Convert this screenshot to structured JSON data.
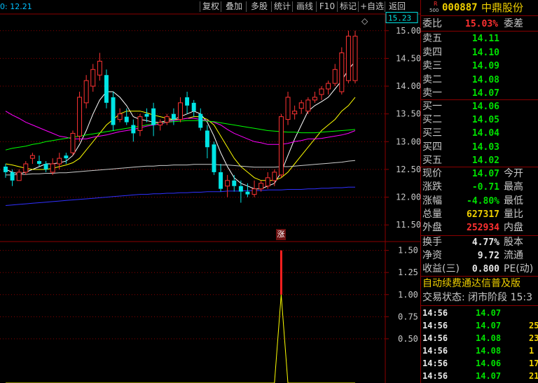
{
  "toolbar": {
    "ohlc_readout": "0: 12.21",
    "buttons": [
      "复权",
      "叠加",
      "多股",
      "统计",
      "画线",
      "F10",
      "标记",
      "+自选",
      "返回"
    ]
  },
  "chart_markers": {
    "zhang": "涨",
    "diamond": "◇"
  },
  "colors": {
    "up": "#ff3333",
    "down": "#00e5e5",
    "ma5": "#ffffff",
    "ma10": "#ffff00",
    "ma20": "#ff00ff",
    "ma30": "#00ff00",
    "ma60": "#cccccc",
    "ma120": "#3030ff",
    "grid": "#8b0000",
    "axis_text": "#c8c8c8"
  },
  "stock": {
    "badge_top": "R",
    "badge_bottom": "500",
    "code": "000887",
    "name": "中鼎股份"
  },
  "weibi": {
    "label": "委比",
    "value": "15.03%",
    "label2": "委差"
  },
  "asks": [
    {
      "label": "卖五",
      "price": "14.11"
    },
    {
      "label": "卖四",
      "price": "14.10"
    },
    {
      "label": "卖三",
      "price": "14.09"
    },
    {
      "label": "卖二",
      "price": "14.08"
    },
    {
      "label": "卖一",
      "price": "14.07"
    }
  ],
  "bids": [
    {
      "label": "买一",
      "price": "14.06"
    },
    {
      "label": "买二",
      "price": "14.05"
    },
    {
      "label": "买三",
      "price": "14.04"
    },
    {
      "label": "买四",
      "price": "14.03"
    },
    {
      "label": "买五",
      "price": "14.02"
    }
  ],
  "quote": [
    {
      "label": "现价",
      "value": "14.07",
      "label2": "今开",
      "color": "green"
    },
    {
      "label": "涨跌",
      "value": "-0.71",
      "label2": "最高",
      "color": "green"
    },
    {
      "label": "涨幅",
      "value": "-4.80%",
      "label2": "最低",
      "color": "green"
    },
    {
      "label": "总量",
      "value": "627317",
      "label2": "量比",
      "color": "yellow"
    },
    {
      "label": "外盘",
      "value": "252934",
      "label2": "内盘",
      "color": "red"
    }
  ],
  "fundamentals": [
    {
      "label": "换手",
      "value": "4.77%",
      "label2": "股本"
    },
    {
      "label": "净资",
      "value": "9.72",
      "label2": "流通"
    },
    {
      "label": "收益(三)",
      "value": "0.800",
      "label2": "PE(动)"
    }
  ],
  "promo_text": "自动续费通达信普及版",
  "trade_status": "交易状态: 闭市阶段 15:3",
  "ticks": [
    {
      "time": "14:56",
      "price": "14.07",
      "vol": "",
      "color": "green"
    },
    {
      "time": "14:56",
      "price": "14.07",
      "vol": "25",
      "color": "green"
    },
    {
      "time": "14:56",
      "price": "14.08",
      "vol": "23",
      "color": "green"
    },
    {
      "time": "14:56",
      "price": "14.08",
      "vol": "1",
      "color": "green"
    },
    {
      "time": "14:56",
      "price": "14.06",
      "vol": "17",
      "color": "green"
    },
    {
      "time": "14:56",
      "price": "14.07",
      "vol": "21",
      "color": "green"
    }
  ],
  "chart_data": [
    {
      "type": "candlestick",
      "title": "",
      "ylim": [
        11.2,
        15.3
      ],
      "yticks": [
        "15.00",
        "14.50",
        "14.00",
        "13.50",
        "13.00",
        "12.50",
        "12.00",
        "11.50"
      ],
      "ytick_values": [
        15.0,
        14.5,
        14.0,
        13.5,
        13.0,
        12.5,
        12.0,
        11.5
      ],
      "last_price_label": "15.23",
      "candles": [
        [
          12.55,
          12.45,
          12.35,
          12.6
        ],
        [
          12.45,
          12.3,
          12.2,
          12.5
        ],
        [
          12.3,
          12.45,
          12.3,
          12.5
        ],
        [
          12.45,
          12.6,
          12.4,
          12.65
        ],
        [
          12.7,
          12.75,
          12.6,
          12.8
        ],
        [
          12.65,
          12.6,
          12.55,
          12.75
        ],
        [
          12.6,
          12.5,
          12.45,
          12.65
        ],
        [
          12.45,
          12.6,
          12.4,
          12.7
        ],
        [
          12.6,
          12.7,
          12.5,
          12.8
        ],
        [
          12.75,
          12.7,
          12.6,
          12.8
        ],
        [
          12.8,
          13.15,
          12.75,
          13.2
        ],
        [
          13.1,
          13.8,
          13.0,
          13.9
        ],
        [
          13.7,
          14.1,
          13.6,
          14.2
        ],
        [
          14.0,
          14.3,
          13.9,
          14.4
        ],
        [
          14.2,
          14.45,
          14.1,
          14.6
        ],
        [
          14.2,
          13.7,
          13.6,
          14.3
        ],
        [
          13.8,
          13.3,
          13.2,
          13.9
        ],
        [
          13.4,
          13.5,
          13.35,
          13.6
        ],
        [
          13.45,
          13.35,
          13.3,
          13.6
        ],
        [
          13.3,
          13.15,
          13.0,
          13.4
        ],
        [
          13.2,
          13.45,
          13.1,
          13.5
        ],
        [
          13.5,
          13.45,
          13.35,
          13.6
        ],
        [
          13.6,
          13.3,
          13.1,
          13.7
        ],
        [
          13.3,
          13.35,
          13.2,
          13.4
        ],
        [
          13.35,
          13.45,
          13.3,
          13.5
        ],
        [
          13.5,
          13.4,
          13.3,
          13.6
        ],
        [
          13.4,
          13.7,
          13.35,
          13.8
        ],
        [
          13.8,
          13.65,
          13.5,
          13.9
        ],
        [
          13.7,
          13.55,
          13.45,
          13.75
        ],
        [
          13.5,
          13.25,
          13.2,
          13.6
        ],
        [
          13.2,
          12.9,
          12.7,
          13.3
        ],
        [
          12.95,
          12.45,
          12.4,
          13.0
        ],
        [
          12.45,
          12.15,
          12.1,
          12.6
        ],
        [
          12.2,
          12.3,
          12.0,
          12.4
        ],
        [
          12.3,
          12.2,
          12.1,
          12.4
        ],
        [
          12.2,
          12.1,
          11.9,
          12.3
        ],
        [
          12.1,
          12.05,
          12.0,
          12.25
        ],
        [
          12.05,
          12.15,
          12.0,
          12.3
        ],
        [
          12.15,
          12.25,
          12.1,
          12.3
        ],
        [
          12.2,
          12.35,
          12.15,
          12.45
        ],
        [
          12.3,
          12.45,
          12.2,
          12.5
        ],
        [
          12.4,
          13.45,
          12.35,
          13.5
        ],
        [
          13.4,
          13.8,
          13.3,
          13.9
        ],
        [
          13.5,
          13.55,
          13.4,
          13.65
        ],
        [
          13.6,
          13.7,
          13.5,
          13.75
        ],
        [
          13.55,
          13.75,
          13.5,
          13.8
        ],
        [
          13.75,
          13.8,
          13.7,
          13.9
        ],
        [
          13.85,
          13.95,
          13.75,
          14.0
        ],
        [
          13.95,
          14.05,
          13.85,
          14.1
        ],
        [
          14.05,
          14.3,
          14.0,
          14.4
        ],
        [
          13.9,
          14.6,
          13.85,
          14.7
        ],
        [
          14.1,
          14.9,
          14.05,
          15.0
        ],
        [
          14.1,
          14.9,
          14.05,
          15.0
        ]
      ],
      "ma": [
        {
          "name": "MA5",
          "color": "#ffffff",
          "values": [
            12.5,
            12.45,
            12.42,
            12.45,
            12.5,
            12.55,
            12.6,
            12.6,
            12.62,
            12.65,
            12.75,
            12.95,
            13.2,
            13.5,
            13.75,
            13.9,
            13.9,
            13.8,
            13.65,
            13.45,
            13.4,
            13.38,
            13.35,
            13.35,
            13.38,
            13.4,
            13.45,
            13.5,
            13.55,
            13.5,
            13.35,
            13.1,
            12.8,
            12.55,
            12.35,
            12.25,
            12.2,
            12.15,
            12.15,
            12.2,
            12.25,
            12.45,
            12.75,
            13.05,
            13.3,
            13.55,
            13.65,
            13.72,
            13.8,
            13.95,
            14.1,
            14.3,
            14.45
          ]
        },
        {
          "name": "MA10",
          "color": "#ffff00",
          "values": [
            12.6,
            12.58,
            12.55,
            12.52,
            12.5,
            12.5,
            12.5,
            12.52,
            12.55,
            12.58,
            12.62,
            12.7,
            12.85,
            13.0,
            13.15,
            13.3,
            13.4,
            13.5,
            13.55,
            13.55,
            13.55,
            13.52,
            13.48,
            13.45,
            13.42,
            13.4,
            13.4,
            13.42,
            13.45,
            13.45,
            13.4,
            13.3,
            13.1,
            12.9,
            12.7,
            12.55,
            12.45,
            12.35,
            12.3,
            12.3,
            12.3,
            12.35,
            12.45,
            12.6,
            12.75,
            12.9,
            13.05,
            13.2,
            13.3,
            13.4,
            13.55,
            13.65,
            13.8
          ]
        },
        {
          "name": "MA20",
          "color": "#ff00ff",
          "values": [
            13.55,
            13.48,
            13.42,
            13.35,
            13.3,
            13.25,
            13.2,
            13.15,
            13.1,
            13.08,
            13.05,
            13.05,
            13.05,
            13.08,
            13.1,
            13.12,
            13.15,
            13.18,
            13.2,
            13.22,
            13.25,
            13.28,
            13.3,
            13.32,
            13.35,
            13.38,
            13.4,
            13.42,
            13.42,
            13.4,
            13.38,
            13.35,
            13.3,
            13.22,
            13.15,
            13.1,
            13.05,
            13.0,
            12.98,
            12.95,
            12.95,
            12.95,
            12.97,
            13.0,
            13.02,
            13.05,
            13.05,
            13.06,
            13.08,
            13.1,
            13.12,
            13.15,
            13.2
          ]
        },
        {
          "name": "MA30",
          "color": "#00ff00",
          "values": [
            12.85,
            12.88,
            12.9,
            12.92,
            12.95,
            12.97,
            13.0,
            13.02,
            13.04,
            13.06,
            13.08,
            13.1,
            13.12,
            13.14,
            13.16,
            13.18,
            13.2,
            13.22,
            13.24,
            13.26,
            13.28,
            13.3,
            13.32,
            13.34,
            13.35,
            13.36,
            13.37,
            13.38,
            13.38,
            13.38,
            13.37,
            13.36,
            13.34,
            13.32,
            13.3,
            13.28,
            13.26,
            13.24,
            13.22,
            13.2,
            13.19,
            13.18,
            13.17,
            13.17,
            13.16,
            13.16,
            13.16,
            13.17,
            13.18,
            13.19,
            13.2,
            13.21,
            13.22
          ]
        },
        {
          "name": "MA60",
          "color": "#cccccc",
          "values": [
            12.4,
            12.4,
            12.41,
            12.41,
            12.42,
            12.42,
            12.43,
            12.43,
            12.44,
            12.44,
            12.45,
            12.46,
            12.47,
            12.48,
            12.49,
            12.5,
            12.51,
            12.52,
            12.53,
            12.54,
            12.55,
            12.56,
            12.56,
            12.57,
            12.57,
            12.58,
            12.58,
            12.58,
            12.59,
            12.59,
            12.59,
            12.59,
            12.58,
            12.58,
            12.57,
            12.56,
            12.55,
            12.54,
            12.54,
            12.54,
            12.54,
            12.55,
            12.55,
            12.56,
            12.57,
            12.58,
            12.59,
            12.6,
            12.61,
            12.62,
            12.63,
            12.65,
            12.66
          ]
        },
        {
          "name": "MA120",
          "color": "#3030ff",
          "values": [
            11.85,
            11.86,
            11.87,
            11.88,
            11.89,
            11.9,
            11.91,
            11.92,
            11.93,
            11.94,
            11.95,
            11.96,
            11.97,
            11.98,
            11.99,
            12.0,
            12.01,
            12.02,
            12.03,
            12.04,
            12.05,
            12.05,
            12.06,
            12.06,
            12.07,
            12.07,
            12.08,
            12.08,
            12.09,
            12.09,
            12.1,
            12.1,
            12.1,
            12.11,
            12.11,
            12.11,
            12.12,
            12.12,
            12.12,
            12.13,
            12.13,
            12.13,
            12.14,
            12.14,
            12.14,
            12.15,
            12.15,
            12.16,
            12.16,
            12.17,
            12.17,
            12.18,
            12.18
          ]
        }
      ]
    },
    {
      "type": "line",
      "title": "",
      "ylim": [
        0,
        1.6
      ],
      "yticks": [
        "1.50",
        "1.25",
        "1.00",
        "0.75",
        "0.50"
      ],
      "ytick_values": [
        1.5,
        1.25,
        1.0,
        0.75,
        0.5
      ],
      "values": [
        0,
        0,
        0,
        0,
        0,
        0,
        0,
        0,
        0,
        0,
        0,
        0,
        0,
        0,
        0,
        0,
        0,
        0,
        0,
        0,
        0,
        0,
        0,
        0,
        0,
        0,
        0,
        0,
        0,
        0,
        0,
        0,
        0,
        0,
        0,
        0,
        0,
        0,
        0,
        0,
        0,
        1,
        0,
        0,
        0,
        0,
        0,
        0,
        0,
        0,
        0,
        0,
        0
      ],
      "bar_index": 41,
      "bar_range": [
        1.0,
        1.5
      ],
      "bar_color": "#ff2020",
      "line_color": "#ffff00"
    }
  ]
}
